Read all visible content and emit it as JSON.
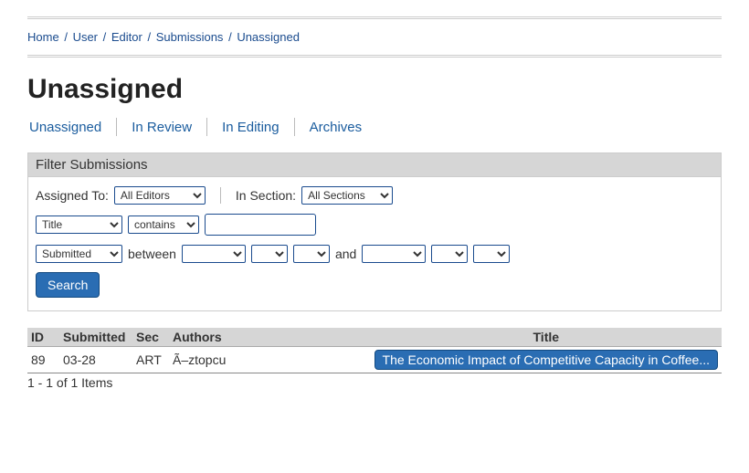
{
  "breadcrumb": {
    "home": "Home",
    "user": "User",
    "editor": "Editor",
    "submissions": "Submissions",
    "unassigned": "Unassigned"
  },
  "page_title": "Unassigned",
  "tabs": {
    "unassigned": "Unassigned",
    "in_review": "In Review",
    "in_editing": "In Editing",
    "archives": "Archives"
  },
  "filter": {
    "header": "Filter Submissions",
    "assigned_to_label": "Assigned To:",
    "assigned_to_value": "All Editors",
    "in_section_label": "In Section:",
    "in_section_value": "All Sections",
    "field_select": "Title",
    "match_select": "contains",
    "text_value": "",
    "date_basis": "Submitted",
    "between_label": "between",
    "and_label": "and",
    "search_label": "Search"
  },
  "table": {
    "headers": {
      "id": "ID",
      "submitted": "Submitted",
      "sec": "Sec",
      "authors": "Authors",
      "title": "Title"
    },
    "row": {
      "id": "89",
      "submitted": "03-28",
      "sec": "ART",
      "authors": "Ã–ztopcu",
      "title": "The Economic Impact of Competitive Capacity in Coffee..."
    }
  },
  "items_count": "1 - 1 of 1 Items"
}
